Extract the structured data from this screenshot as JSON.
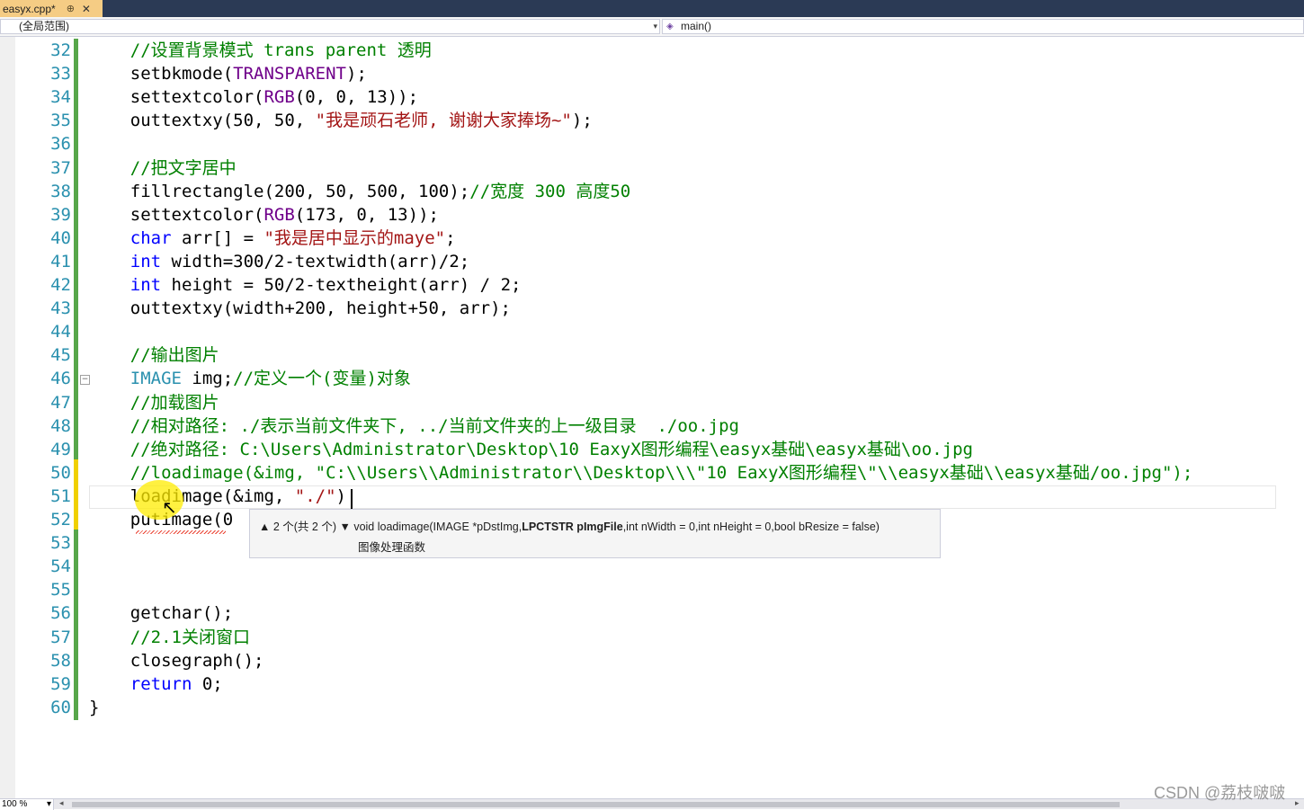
{
  "tab": {
    "title": "easyx.cpp*",
    "pin": "⊕",
    "close": "✕"
  },
  "nav": {
    "scope": "(全局范围)",
    "function": "main()"
  },
  "lines": [
    {
      "n": "32",
      "segs": [
        {
          "c": "cm",
          "t": "    //设置背景模式 trans parent 透明"
        }
      ]
    },
    {
      "n": "33",
      "segs": [
        {
          "c": "",
          "t": "    setbkmode("
        },
        {
          "c": "mc",
          "t": "TRANSPARENT"
        },
        {
          "c": "",
          "t": ");"
        }
      ]
    },
    {
      "n": "34",
      "segs": [
        {
          "c": "",
          "t": "    settextcolor("
        },
        {
          "c": "mc",
          "t": "RGB"
        },
        {
          "c": "",
          "t": "(0, 0, 13));"
        }
      ]
    },
    {
      "n": "35",
      "segs": [
        {
          "c": "",
          "t": "    outtextxy(50, 50, "
        },
        {
          "c": "st",
          "t": "\"我是顽石老师, 谢谢大家捧场~\""
        },
        {
          "c": "",
          "t": ");"
        }
      ]
    },
    {
      "n": "36",
      "segs": []
    },
    {
      "n": "37",
      "segs": [
        {
          "c": "cm",
          "t": "    //把文字居中"
        }
      ]
    },
    {
      "n": "38",
      "segs": [
        {
          "c": "",
          "t": "    fillrectangle(200, 50, 500, 100);"
        },
        {
          "c": "cm",
          "t": "//宽度 300 高度50"
        }
      ]
    },
    {
      "n": "39",
      "segs": [
        {
          "c": "",
          "t": "    settextcolor("
        },
        {
          "c": "mc",
          "t": "RGB"
        },
        {
          "c": "",
          "t": "(173, 0, 13));"
        }
      ]
    },
    {
      "n": "40",
      "segs": [
        {
          "c": "kw",
          "t": "    char"
        },
        {
          "c": "",
          "t": " arr[] = "
        },
        {
          "c": "st",
          "t": "\"我是居中显示的maye\""
        },
        {
          "c": "",
          "t": ";"
        }
      ]
    },
    {
      "n": "41",
      "segs": [
        {
          "c": "kw",
          "t": "    int"
        },
        {
          "c": "",
          "t": " width=300/2-textwidth(arr)/2;"
        }
      ]
    },
    {
      "n": "42",
      "segs": [
        {
          "c": "kw",
          "t": "    int"
        },
        {
          "c": "",
          "t": " height = 50/2-textheight(arr) / 2;"
        }
      ]
    },
    {
      "n": "43",
      "segs": [
        {
          "c": "",
          "t": "    outtextxy(width+200, height+50, arr);"
        }
      ]
    },
    {
      "n": "44",
      "segs": []
    },
    {
      "n": "45",
      "segs": [
        {
          "c": "cm",
          "t": "    //输出图片"
        }
      ]
    },
    {
      "n": "46",
      "segs": [
        {
          "c": "ty",
          "t": "    IMAGE"
        },
        {
          "c": "",
          "t": " img;"
        },
        {
          "c": "cm",
          "t": "//定义一个(变量)对象"
        }
      ]
    },
    {
      "n": "47",
      "segs": [
        {
          "c": "cm",
          "t": "    //加载图片"
        }
      ]
    },
    {
      "n": "48",
      "segs": [
        {
          "c": "cm",
          "t": "    //相对路径: ./表示当前文件夹下, ../当前文件夹的上一级目录  ./oo.jpg"
        }
      ]
    },
    {
      "n": "49",
      "segs": [
        {
          "c": "cm",
          "t": "    //绝对路径: C:\\Users\\Administrator\\Desktop\\10 EaxyX图形编程\\easyx基础\\easyx基础\\oo.jpg"
        }
      ]
    },
    {
      "n": "50",
      "segs": [
        {
          "c": "cm",
          "t": "    //loadimage(&img, \"C:\\\\Users\\\\Administrator\\\\Desktop\\\\\\\"10 EaxyX图形编程\\\"\\\\easyx基础\\\\easyx基础/oo.jpg\");"
        }
      ]
    },
    {
      "n": "51",
      "segs": [
        {
          "c": "",
          "t": "    loadimage(&img, "
        },
        {
          "c": "st",
          "t": "\"./\""
        },
        {
          "c": "",
          "t": ")"
        }
      ]
    },
    {
      "n": "52",
      "segs": [
        {
          "c": "",
          "t": "    putimage(0"
        }
      ]
    },
    {
      "n": "53",
      "segs": []
    },
    {
      "n": "54",
      "segs": []
    },
    {
      "n": "55",
      "segs": []
    },
    {
      "n": "56",
      "segs": [
        {
          "c": "",
          "t": "    getchar();"
        }
      ]
    },
    {
      "n": "57",
      "segs": [
        {
          "c": "cm",
          "t": "    //2.1关闭窗口"
        }
      ]
    },
    {
      "n": "58",
      "segs": [
        {
          "c": "",
          "t": "    closegraph();"
        }
      ]
    },
    {
      "n": "59",
      "segs": [
        {
          "c": "kw",
          "t": "    return"
        },
        {
          "c": "",
          "t": " 0;"
        }
      ]
    },
    {
      "n": "60",
      "segs": [
        {
          "c": "",
          "t": "}"
        }
      ]
    }
  ],
  "tooltip": {
    "counter": "▲ 2 个(共 2 个) ▼",
    "sig_prefix": " void loadimage(IMAGE *pDstImg,",
    "sig_bold": "LPCTSTR pImgFile",
    "sig_suffix": ",int nWidth = 0,int nHeight = 0,bool bResize = false)",
    "description": "图像处理函数"
  },
  "statusbar": {
    "zoom": "100 %",
    "zoom_dd": "▾",
    "scroll_left": "◂",
    "scroll_right": "▸"
  },
  "watermark": "CSDN @荔枝啵啵",
  "colors": {
    "keyword": "#0000ff",
    "comment": "#008000",
    "string": "#a31515",
    "macro": "#6f008a",
    "type": "#2b91af",
    "line_number": "#2b91af",
    "saved_change": "#57a64a",
    "unsaved_change": "#f0d000"
  }
}
